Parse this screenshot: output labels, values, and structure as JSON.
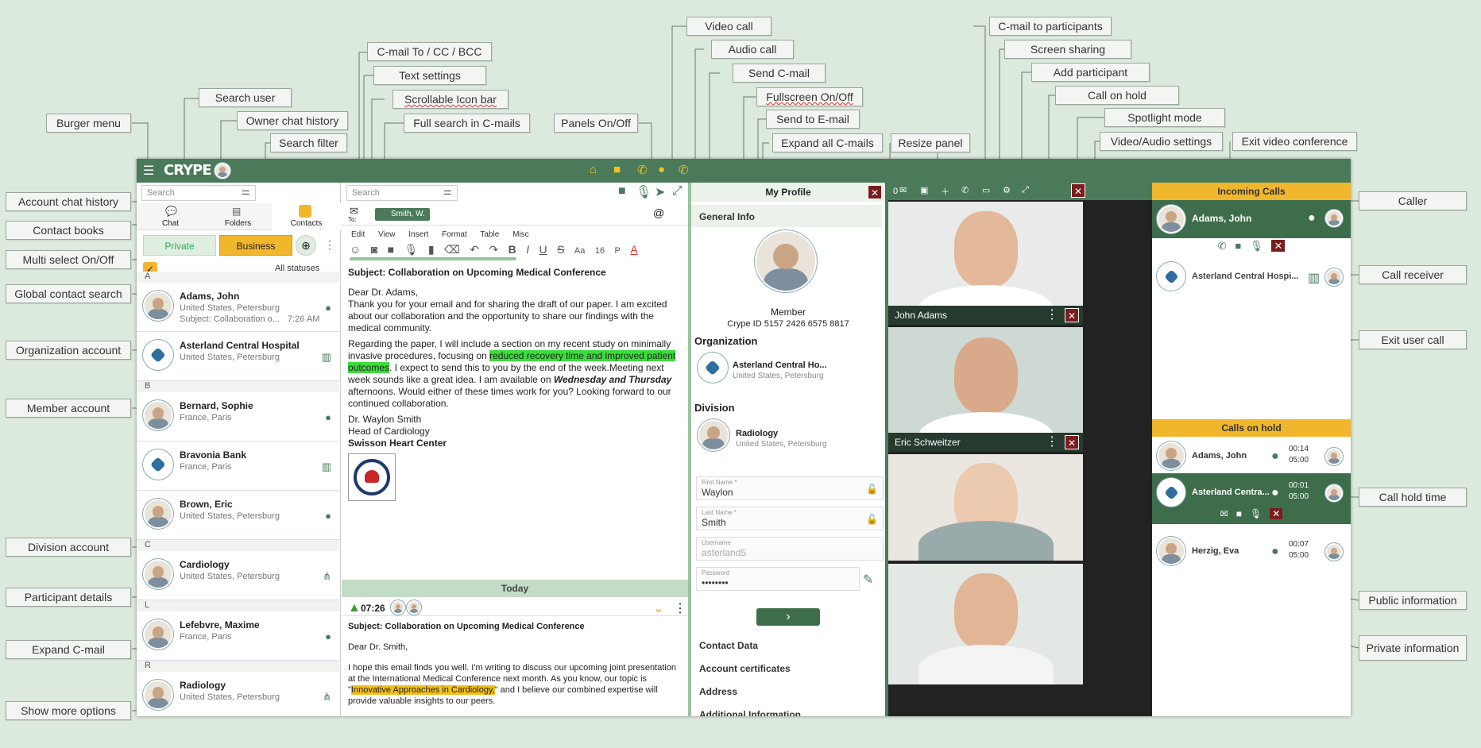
{
  "labels": {
    "burger_menu": "Burger menu",
    "search_user": "Search user",
    "owner_chat_history": "Owner chat history",
    "search_filter": "Search filter",
    "cmail_to_cc_bcc": "C-mail To / CC / BCC",
    "text_settings": "Text settings",
    "scrollable_icon_bar": "Scrollable Icon bar",
    "full_search_cmails": "Full search in C-mails",
    "panels_on_off": "Panels On/Off",
    "video_call": "Video call",
    "audio_call": "Audio call",
    "send_cmail": "Send C-mail",
    "fullscreen": "Fullscreen On/Off",
    "send_to_email": "Send to E-mail",
    "expand_all_cmails": "Expand all C-mails",
    "resize_panel": "Resize panel",
    "cmail_to_participants": "C-mail to participants",
    "screen_sharing": "Screen sharing",
    "add_participant": "Add participant",
    "call_on_hold": "Call on hold",
    "spotlight_mode": "Spotlight mode",
    "video_audio_settings": "Video/Audio settings",
    "exit_video_conference": "Exit video conference",
    "account_chat_history": "Account chat history",
    "contact_books": "Contact books",
    "multi_select": "Multi select On/Off",
    "global_contact_search": "Global contact search",
    "organization_account": "Organization account",
    "member_account": "Member account",
    "division_account": "Division account",
    "participant_details": "Participant details",
    "expand_cmail": "Expand C-mail",
    "show_more_options": "Show more options",
    "caller": "Caller",
    "call_receiver": "Call receiver",
    "exit_user_call": "Exit user call",
    "call_hold_time": "Call hold time",
    "public_information": "Public information",
    "private_information": "Private information"
  },
  "app": {
    "logo": "CRYPE",
    "search_placeholder": "Search",
    "tabs": {
      "chat": "Chat",
      "folders": "Folders",
      "contacts": "Contacts"
    },
    "books": {
      "private": "Private",
      "business": "Business"
    },
    "all_statuses": "All statuses",
    "contacts": [
      {
        "letter": "A",
        "name": "Adams, John",
        "sub": "United States, Petersburg",
        "sub2": "Subject: Collaboration o...",
        "time": "7:26 AM",
        "type": "member"
      },
      {
        "name": "Asterland Central Hospital",
        "sub": "United States, Petersburg",
        "type": "org"
      },
      {
        "letter": "B",
        "name": "Bernard, Sophie",
        "sub": "France, Paris",
        "type": "member"
      },
      {
        "name": "Bravonia Bank",
        "sub": "France, Paris",
        "type": "org"
      },
      {
        "name": "Brown, Eric",
        "sub": "United States, Petersburg",
        "type": "member"
      },
      {
        "letter": "C",
        "name": "Cardiology",
        "sub": "United States, Petersburg",
        "type": "division"
      },
      {
        "letter": "L",
        "name": "Lefebvre, Maxime",
        "sub": "France, Paris",
        "type": "member"
      },
      {
        "letter": "R",
        "name": "Radiology",
        "sub": "United States, Petersburg",
        "type": "division"
      }
    ],
    "compose": {
      "to_label": "To:",
      "recipient": "Smith, W.",
      "menu": [
        "Edit",
        "View",
        "Insert",
        "Format",
        "Table",
        "Misc"
      ],
      "font_size": "16",
      "para": "P",
      "subject": "Subject: Collaboration on Upcoming Medical Conference",
      "greeting": "Dear Dr. Adams,",
      "p1": "Thank you for your email and for sharing the draft of our paper. I am excited about our collaboration and the opportunity to share our findings with the medical community.",
      "p2a": "Regarding the paper, I will include a section on my recent study on minimally invasive procedures, focusing on ",
      "p2hl": "reduced recovery time and improved patient outcomes",
      "p2b": ". I expect to send this to you by the end of the week.Meeting next week sounds like a great idea. I am available on ",
      "p2bold": "Wednesday and Thursday",
      "p2c": " afternoons. Would either of these times work for you? Looking forward to our continued collaboration.",
      "sig1": "Dr. Waylon Smith",
      "sig2": "Head of Cardiology",
      "sig3": "Swisson Heart Center"
    },
    "history": {
      "day": "Today",
      "time": "07:26",
      "subject": "Subject: Collaboration on Upcoming Medical Conference",
      "greeting": "Dear Dr. Smith,",
      "p1a": "I hope this email finds you well. I'm writing to discuss our upcoming joint presentation at the International Medical Conference next month. As you know, our topic is \"",
      "p1hl": "Innovative Approaches in Cardiology,",
      "p1b": "\" and I believe our combined expertise will provide valuable insights to our peers."
    },
    "profile": {
      "title": "My Profile",
      "general_info": "General Info",
      "role": "Member",
      "crype_id": "Crype ID 5157 2426 6575 8817",
      "organization": "Organization",
      "org_name": "Asterland Central Ho...",
      "org_sub": "United States, Petersburg",
      "division": "Division",
      "div_name": "Radiology",
      "div_sub": "United States, Petersburg",
      "first_name_label": "First Name *",
      "first_name": "Waylon",
      "last_name_label": "Last Name *",
      "last_name": "Smith",
      "username_label": "Username",
      "username": "asterland5",
      "password_label": "Password",
      "password": "••••••••",
      "sections": [
        "Contact Data",
        "Account certificates",
        "Address",
        "Additional Information"
      ]
    },
    "video": {
      "count": "0",
      "tiles": [
        "John Adams",
        "Eric Schweitzer",
        "",
        ""
      ]
    },
    "calls": {
      "incoming_title": "Incoming Calls",
      "caller": "Adams, John",
      "receiver": "Asterland Central Hospi...",
      "hold_title": "Calls on hold",
      "hold": [
        {
          "name": "Adams, John",
          "t1": "00:14",
          "t2": "05:00"
        },
        {
          "name": "Asterland Centra...",
          "t1": "00:01",
          "t2": "05:00"
        },
        {
          "name": "Herzig, Eva",
          "t1": "00:07",
          "t2": "05:00"
        }
      ]
    }
  }
}
